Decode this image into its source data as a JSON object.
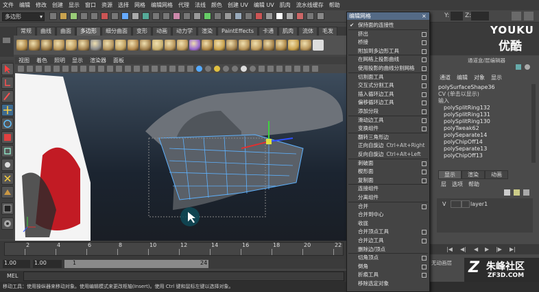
{
  "menubar": [
    "文件",
    "编辑",
    "修改",
    "创建",
    "显示",
    "窗口",
    "资源",
    "选择",
    "网格",
    "编辑网格",
    "代理",
    "法线",
    "颜色",
    "创建 UV",
    "编辑 UV",
    "肌肉",
    "流水线缓存",
    "帮助"
  ],
  "status": {
    "mode_menu": "多边形",
    "coord_labels": [
      "Y:",
      "Z:"
    ]
  },
  "shelf_tabs": [
    "常规",
    "曲线",
    "曲面",
    "多边形",
    "细分曲面",
    "变形",
    "动画",
    "动力学",
    "渲染",
    "PaintEffects",
    "卡通",
    "肌肉",
    "流体",
    "毛发"
  ],
  "shelf_active": 3,
  "viewport_menu": [
    "视图",
    "着色",
    "照明",
    "显示",
    "渲染器",
    "面板"
  ],
  "edit_mesh": {
    "title": "编辑网格",
    "items": [
      {
        "label": "保持面的连接性",
        "checked": true
      },
      {
        "label": "挤出",
        "opt": true
      },
      {
        "label": "桥接",
        "opt": true
      },
      {
        "label": "附加到多边形工具",
        "opt": true
      },
      {
        "label": "在网格上投影曲线",
        "opt": true
      },
      {
        "label": "使用投影的曲线分割网格",
        "opt": true
      },
      {
        "label": "切割面工具",
        "opt": true
      },
      {
        "label": "交互式分割工具",
        "opt": true
      },
      {
        "label": "插入循环边工具",
        "opt": true
      },
      {
        "label": "偏移循环边工具",
        "opt": true
      },
      {
        "label": "添加分段",
        "opt": true
      },
      {
        "label": "滑动边工具",
        "opt": true
      },
      {
        "label": "变换组件",
        "opt": true
      },
      {
        "label": "翻转三角形边",
        "opt": false
      },
      {
        "label": "正向自旋边",
        "shortcut": "Ctrl+Alt+Right"
      },
      {
        "label": "反向自旋边",
        "shortcut": "Ctrl+Alt+Left"
      },
      {
        "label": "刺破面",
        "opt": true
      },
      {
        "label": "楔形面",
        "opt": true
      },
      {
        "label": "复制面",
        "opt": true
      },
      {
        "label": "连接组件",
        "opt": false
      },
      {
        "label": "分离组件",
        "opt": false
      },
      {
        "label": "合并",
        "opt": true
      },
      {
        "label": "合并到中心",
        "opt": false
      },
      {
        "label": "收拢",
        "opt": false
      },
      {
        "label": "合并顶点工具",
        "opt": true
      },
      {
        "label": "合并边工具",
        "opt": true
      },
      {
        "label": "删除边/顶点",
        "opt": false
      },
      {
        "label": "切角顶点",
        "opt": true
      },
      {
        "label": "倒角",
        "opt": true
      },
      {
        "label": "折痕工具",
        "opt": true
      },
      {
        "label": "移除选定对象",
        "opt": false
      }
    ]
  },
  "channel_box": {
    "header": "通道盒/层编辑器",
    "tabs": [
      "通道",
      "编辑",
      "对象",
      "显示"
    ],
    "object": "polySurfaceShape36",
    "cv_label": "CV (单击以显示)",
    "inputs_label": "输入",
    "history": [
      "polySplitRing132",
      "polySplitRing131",
      "polySplitRing130",
      "polyTweak62",
      "polySeparate14",
      "polyChipOff14",
      "polySeparate13",
      "polyChipOff13"
    ]
  },
  "layer_editor": {
    "tabs": [
      "显示",
      "渲染",
      "动画"
    ],
    "menu": [
      "层",
      "选项",
      "帮助"
    ],
    "layer_visible": "V",
    "layer_name": "layer1"
  },
  "timeline": {
    "ticks": [
      "2",
      "4",
      "6",
      "8",
      "10",
      "12",
      "14",
      "16",
      "18",
      "20",
      "22"
    ],
    "start": "1.00",
    "start2": "1.00",
    "current": "1",
    "end": "24"
  },
  "mel": {
    "label": "MEL"
  },
  "playback": {
    "no_char": "无动画层"
  },
  "helpline": "移动工具：使用操纵器来移动对象。使用编辑模式来更改枢轴(Insert)。使用 Ctrl 键和鼠标左键以选择对象。",
  "watermarks": {
    "youku": "YOUKU",
    "youku_cn": "优酷",
    "site_cn": "朱峰社区",
    "site": "ZF3D.COM"
  }
}
